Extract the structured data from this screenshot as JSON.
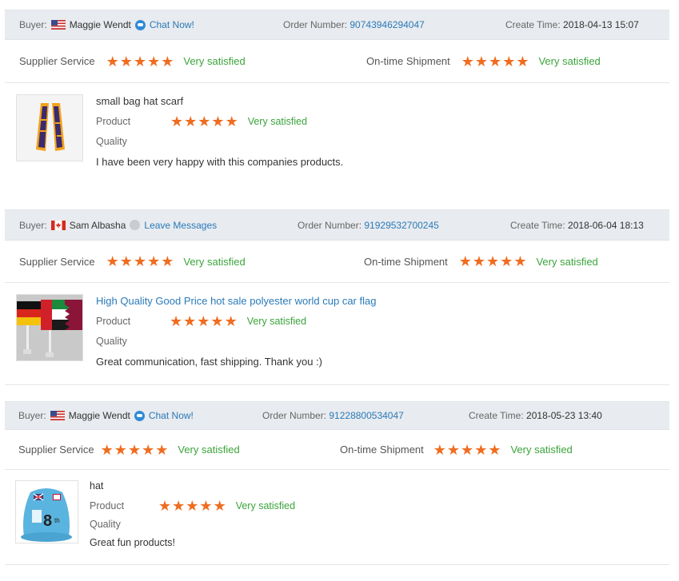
{
  "labels": {
    "buyer": "Buyer:",
    "order_number": "Order Number:",
    "create_time": "Create Time:",
    "supplier_service": "Supplier Service",
    "ontime_shipment": "On-time Shipment",
    "product": "Product",
    "quality": "Quality"
  },
  "reviews": [
    {
      "buyer": "Maggie Wendt",
      "buyer_flag": "us-flag-icon",
      "contact_label": "Chat Now!",
      "contact_icon": "chat-icon",
      "order_number": "90743946294047",
      "create_time": "2018-04-13 15:07",
      "supplier_service_rating": 5,
      "supplier_service_text": "Very satisfied",
      "ontime_rating": 5,
      "ontime_text": "Very satisfied",
      "product_title": "small bag hat scarf",
      "product_rating": 5,
      "product_text": "Very satisfied",
      "comment": "I have been very happy with this companies products."
    },
    {
      "buyer": "Sam Albasha",
      "buyer_flag": "canada-flag-icon",
      "contact_label": "Leave Messages",
      "contact_icon": "message-icon",
      "order_number": "91929532700245",
      "create_time": "2018-06-04 18:13",
      "supplier_service_rating": 5,
      "supplier_service_text": "Very satisfied",
      "ontime_rating": 5,
      "ontime_text": "Very satisfied",
      "product_title": "High Quality Good Price hot sale polyester world cup car flag",
      "product_rating": 5,
      "product_text": "Very satisfied",
      "comment": "Great communication, fast shipping. Thank you :)"
    },
    {
      "buyer": "Maggie Wendt",
      "buyer_flag": "us-flag-icon",
      "contact_label": "Chat Now!",
      "contact_icon": "chat-icon",
      "order_number": "91228800534047",
      "create_time": "2018-05-23 13:40",
      "supplier_service_rating": 5,
      "supplier_service_text": "Very satisfied",
      "ontime_rating": 5,
      "ontime_text": "Very satisfied",
      "product_title": "hat",
      "product_rating": 5,
      "product_text": "Very satisfied",
      "comment": "Great fun products!"
    }
  ],
  "colors": {
    "header_bg": "#e8ebef",
    "link": "#2a7ab8",
    "star": "#f06c1f",
    "satisfied": "#3ba43b"
  }
}
